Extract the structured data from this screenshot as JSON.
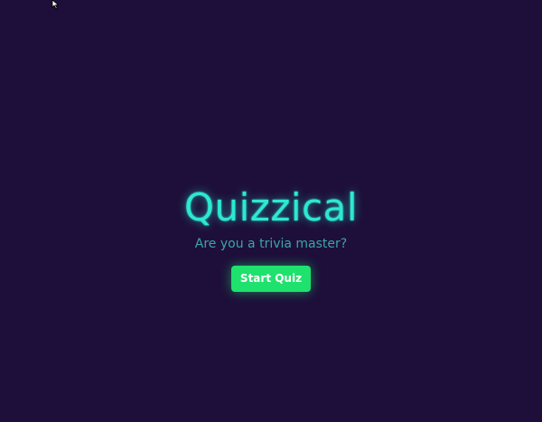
{
  "app": {
    "title": "Quizzical",
    "subtitle": "Are you a trivia master?",
    "start_label": "Start Quiz"
  },
  "icons": {
    "cursor": "mouse-pointer-icon"
  },
  "colors": {
    "background": "#1e0f3a",
    "title": "#2de8d2",
    "subtitle": "#3aa6a4",
    "button": "#1ee26d",
    "button_text": "#ffffff"
  }
}
